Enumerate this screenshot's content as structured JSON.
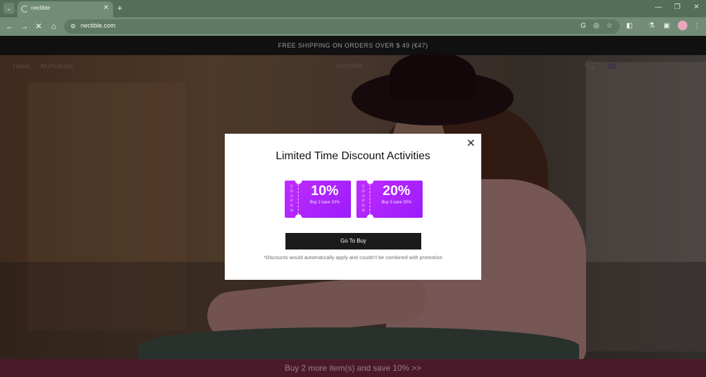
{
  "browser": {
    "tab": {
      "title": "nectible"
    },
    "new_tab_symbol": "+",
    "tab_list_symbol": "⌄",
    "tab_close_symbol": "✕",
    "window_controls": {
      "minimize": "—",
      "restore": "❐",
      "close": "✕"
    },
    "nav": {
      "back": "←",
      "forward": "→",
      "stop": "✕",
      "home": "⌂"
    },
    "url": "nectible.com",
    "icons": [
      "google-lens-icon",
      "eye-off-icon",
      "bookmark-star-icon",
      "extensions-icon",
      "labs-flask-icon",
      "side-panel-icon",
      "profile-avatar",
      "menu-kebab-icon"
    ]
  },
  "site": {
    "announcement": "FREE SHIPPING ON ORDERS OVER $ 49 (€47)",
    "nav": {
      "home": "Home",
      "all_products": "All Products",
      "brand": "nectible"
    },
    "bottom_bar": "Buy 2 more item(s) and save 10%  >>"
  },
  "modal": {
    "title": "Limited Time Discount Activities",
    "close_symbol": "✕",
    "coupons": [
      {
        "stub": "COUPON",
        "percent": "10%",
        "desc": "Buy 2 save 10%"
      },
      {
        "stub": "COUPON",
        "percent": "20%",
        "desc": "Buy 3 save 20%"
      }
    ],
    "button": "Go To Buy",
    "disclaimer": "*Discounts would automatically apply and couldn't be combined with promotion"
  },
  "colors": {
    "coupon": "#b424ff",
    "bottom_bar": "#4a1a2b",
    "browser_frame": "#536e5a"
  }
}
